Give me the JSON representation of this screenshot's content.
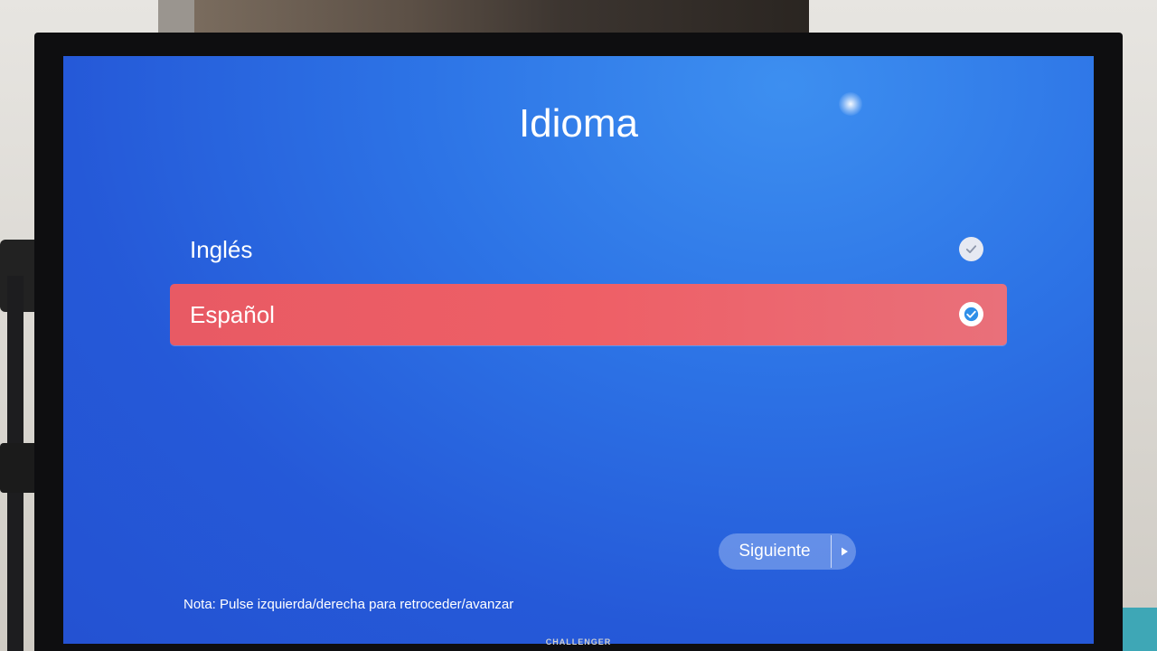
{
  "screen": {
    "title": "Idioma",
    "languages": [
      {
        "label": "Inglés",
        "selected": false
      },
      {
        "label": "Español",
        "selected": true
      }
    ],
    "next_button_label": "Siguiente",
    "note": "Nota: Pulse izquierda/derecha para retroceder/avanzar"
  },
  "tv": {
    "brand": "CHALLENGER"
  },
  "colors": {
    "screen_background": "#2559d8",
    "selected_row": "#ee5f66",
    "check_mark": "#2f8fe8",
    "text": "#ffffff"
  },
  "icons": {
    "language_check": "check-circle-icon",
    "next_arrow": "play-arrow-icon"
  }
}
